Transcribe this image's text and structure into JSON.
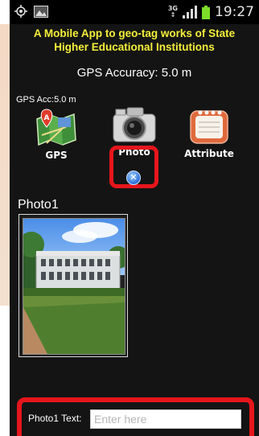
{
  "status_bar": {
    "time": "19:27",
    "network": "3G",
    "icons": [
      "location-icon",
      "gallery-notification-icon",
      "signal-icon",
      "battery-icon"
    ]
  },
  "header": {
    "title_line1": "A Mobile App to geo-tag works of State",
    "title_line2": "Higher Educational Institutions"
  },
  "gps_accuracy_main": "GPS Accuracy: 5.0 m",
  "gps_accuracy_small": "GPS Acc:5.0 m",
  "toolbar": {
    "gps_label": "GPS",
    "photo_label": "Photo",
    "attribute_label": "Attribute"
  },
  "photo_section": {
    "heading": "Photo1"
  },
  "form": {
    "label": "Photo1 Text:",
    "placeholder": "Enter here",
    "value": ""
  },
  "colors": {
    "title": "#f4ef3a",
    "highlight": "#e6161c",
    "background": "#141414"
  }
}
